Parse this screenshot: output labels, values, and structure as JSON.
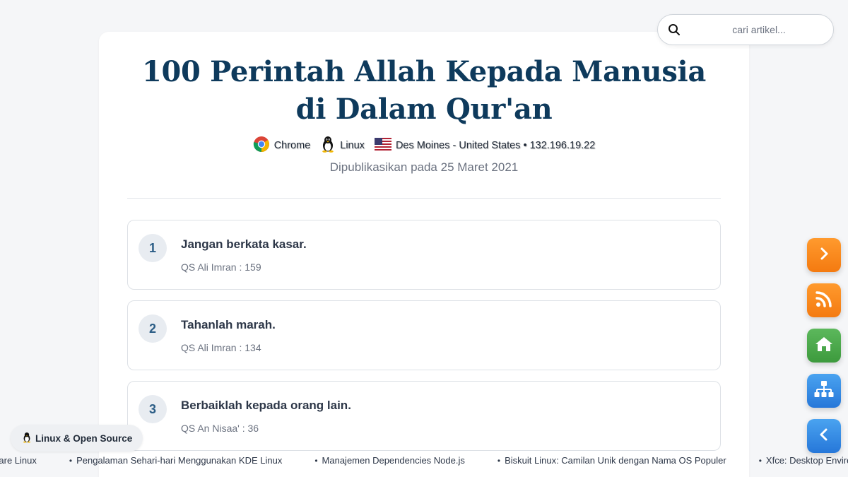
{
  "search": {
    "placeholder": "cari artikel..."
  },
  "article": {
    "title": "100 Perintah Allah Kepada Manusia di Dalam Qur'an",
    "meta": {
      "browser": "Chrome",
      "os": "Linux",
      "location": "Des Moines - United States • 132.196.19.22"
    },
    "published": "Dipublikasikan pada 25 Maret 2021"
  },
  "commands": [
    {
      "number": "1",
      "text": "Jangan berkata kasar.",
      "reference": "QS Ali Imran : 159"
    },
    {
      "number": "2",
      "text": "Tahanlah marah.",
      "reference": "QS Ali Imran : 134"
    },
    {
      "number": "3",
      "text": "Berbaiklah kepada orang lain.",
      "reference": "QS An Nisaa' : 36"
    }
  ],
  "category": {
    "label": "Linux & Open Source"
  },
  "ticker": [
    {
      "title": "ckware Linux"
    },
    {
      "title": "Pengalaman Sehari-hari Menggunakan KDE Linux"
    },
    {
      "title": "Manajemen Dependencies Node.js"
    },
    {
      "title": "Biskuit Linux: Camilan Unik dengan Nama OS Populer"
    },
    {
      "title": "Xfce: Desktop Enviro"
    }
  ],
  "float_buttons": [
    {
      "icon": "chevron-right-icon",
      "color": "#f58a1f"
    },
    {
      "icon": "rss-icon",
      "color": "#f58a1f"
    },
    {
      "icon": "home-icon",
      "color": "#4caf50"
    },
    {
      "icon": "sitemap-icon",
      "color": "#2f86e3"
    },
    {
      "icon": "chevron-left-icon",
      "color": "#2f86e3"
    }
  ]
}
